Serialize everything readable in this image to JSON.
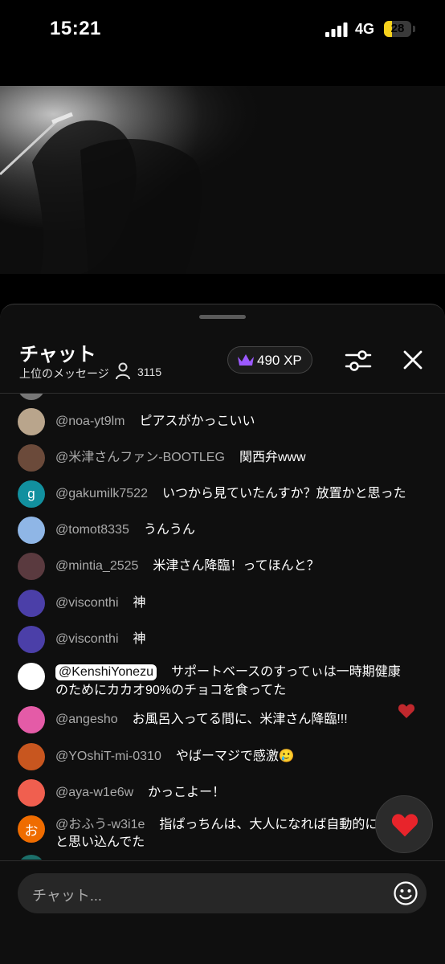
{
  "status_bar": {
    "time": "15:21",
    "network": "4G",
    "battery": "28",
    "battery_level": 0.28
  },
  "chat": {
    "title": "チャット",
    "subtitle": "上位のメッセージ",
    "viewer_count": "3115",
    "xp": "490 XP",
    "input_placeholder": "チャット..."
  },
  "messages": [
    {
      "author": "@noa-yt9lm",
      "text": "ピアスがかっこいい",
      "avatar_color": "#b9a58c",
      "avatar_letter": ""
    },
    {
      "author": "@米津さんファン-BOOTLEG",
      "text": "関西弁www",
      "avatar_color": "#6b4a3a",
      "avatar_letter": ""
    },
    {
      "author": "@gakumilk7522",
      "text": "いつから見ていたんすか？放置かと思った",
      "avatar_color": "#12909f",
      "avatar_letter": "g"
    },
    {
      "author": "@tomot8335",
      "text": "うんうん",
      "avatar_color": "#8fb6e6",
      "avatar_letter": ""
    },
    {
      "author": "@mintia_2525",
      "text": "米津さん降臨！ってほんと？",
      "avatar_color": "#5a3a3f",
      "avatar_letter": ""
    },
    {
      "author": "@visconthi",
      "text": "神",
      "avatar_color": "#4b3fa8",
      "avatar_letter": ""
    },
    {
      "author": "@visconthi",
      "text": "神",
      "avatar_color": "#4b3fa8",
      "avatar_letter": ""
    },
    {
      "author": "@KenshiYonezu",
      "text": "サポートベースのすってぃは一時期健康",
      "text2": "のためにカカオ90%のチョコを食ってた",
      "avatar_color": "#ffffff",
      "avatar_letter": ""
    },
    {
      "author": "@angesho",
      "text": "お風呂入ってる間に、米津さん降臨!!!",
      "avatar_color": "#e45ba7",
      "avatar_letter": ""
    },
    {
      "author": "@YOshiT-mi-0310",
      "text": "やばーマジで感激🥲",
      "avatar_color": "#c8561f",
      "avatar_letter": ""
    },
    {
      "author": "@aya-w1e6w",
      "text": "かっこよー！",
      "avatar_color": "#f05f4f",
      "avatar_letter": ""
    },
    {
      "author": "@おふう-w3i1e",
      "text": "指ぱっちんは、大人になれば自動的に",
      "text2": "と思い込んでた",
      "avatar_color": "#ef6c00",
      "avatar_letter": "お"
    }
  ],
  "colors": {
    "heart": "#e8242b",
    "crown": "#9b59ff",
    "panel": "#0f0f0f"
  },
  "icons": [
    "signal-icon",
    "battery-icon",
    "person-icon",
    "crown-icon",
    "filter-icon",
    "close-icon",
    "heart-icon",
    "emoji-icon"
  ]
}
